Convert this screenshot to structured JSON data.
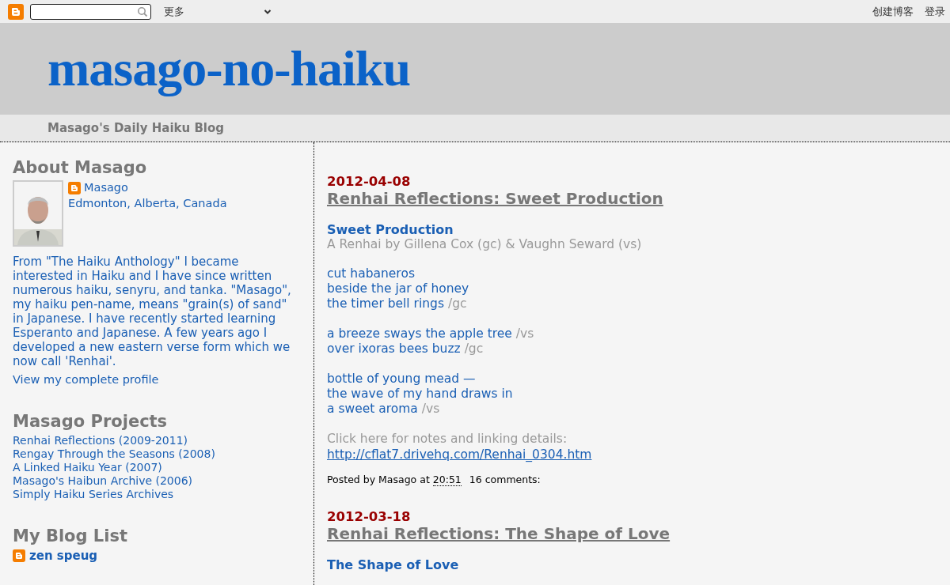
{
  "navbar": {
    "more": "更多",
    "links": [
      "创建博客",
      "登录"
    ]
  },
  "header": {
    "title": "masago-no-haiku",
    "description": "Masago's Daily Haiku Blog"
  },
  "sidebar": {
    "about": {
      "heading": "About Masago",
      "name": "Masago",
      "location": "Edmonton, Alberta, Canada",
      "bio": "From \"The Haiku Anthology\" I became interested in Haiku and I have since written numerous haiku, senyru, and tanka. \"Masago\", my haiku pen-name, means \"grain(s) of sand\" in Japanese. I have recently started learning Esperanto and Japanese. A few years ago I developed a new eastern verse form which we now call 'Renhai'.",
      "profile_link": "View my complete profile"
    },
    "projects": {
      "heading": "Masago Projects",
      "items": [
        "Renhai Reflections (2009-2011)",
        "Rengay Through the Seasons (2008)",
        "A Linked Haiku Year (2007)",
        "Masago's Haibun Archive (2006)",
        "Simply Haiku Series Archives"
      ]
    },
    "blog_list": {
      "heading": "My Blog List",
      "items": [
        {
          "name": "zen speug"
        }
      ]
    }
  },
  "posts": [
    {
      "date": "2012-04-08",
      "title": "Renhai Reflections: Sweet Production",
      "subtitle": "Sweet Production",
      "byline": "A Renhai by Gillena Cox (gc) & Vaughn Seward (vs)",
      "stanzas": [
        [
          {
            "text": "cut habaneros"
          },
          {
            "text": "beside the jar of honey"
          },
          {
            "text": "the timer bell rings",
            "signature": "/gc"
          }
        ],
        [
          {
            "text": "a breeze sways the apple tree",
            "signature": "/vs"
          },
          {
            "text": "over ixoras bees buzz",
            "signature": "/gc"
          }
        ],
        [
          {
            "text": "bottle of young mead —"
          },
          {
            "text": "the wave of my hand draws in"
          },
          {
            "text": "a sweet aroma",
            "signature": "/vs"
          }
        ]
      ],
      "notes": "Click here for notes and linking details:",
      "link": "http://cflat7.drivehq.com/Renhai_0304.htm",
      "footer": {
        "posted_by": "Posted by Masago at",
        "time": "20:51",
        "comments": "16 comments:"
      }
    },
    {
      "date": "2012-03-18",
      "title": "Renhai Reflections: The Shape of Love",
      "subtitle": "The Shape of Love"
    }
  ]
}
